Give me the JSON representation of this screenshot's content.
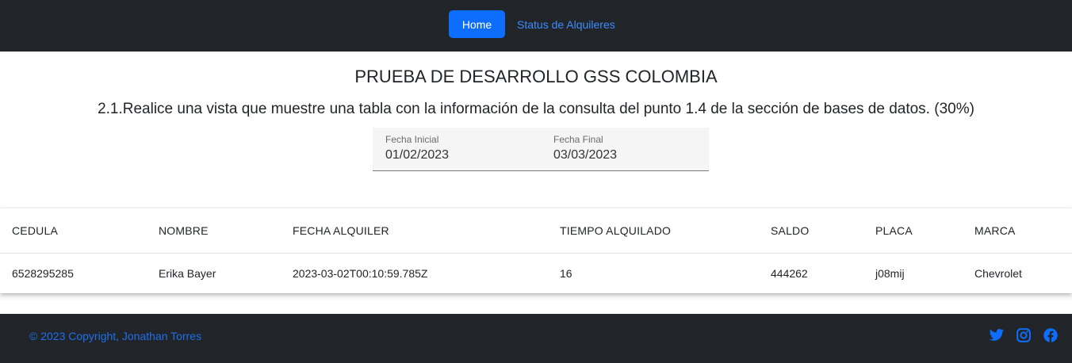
{
  "nav": {
    "home_label": "Home",
    "status_label": "Status de Alquileres"
  },
  "page": {
    "title": "PRUEBA DE DESARROLLO GSS COLOMBIA",
    "subtitle": "2.1.Realice una vista que muestre una tabla con la información de la consulta del punto 1.4 de la sección de bases de datos. (30%)"
  },
  "filters": {
    "start_label": "Fecha Inicial",
    "start_value": "01/02/2023",
    "end_label": "Fecha Final",
    "end_value": "03/03/2023"
  },
  "table": {
    "columns": [
      "CEDULA",
      "NOMBRE",
      "FECHA ALQUILER",
      "TIEMPO ALQUILADO",
      "SALDO",
      "PLACA",
      "MARCA"
    ],
    "rows": [
      [
        "6528295285",
        "Erika Bayer",
        "2023-03-02T00:10:59.785Z",
        "16",
        "444262",
        "j08mij",
        "Chevrolet"
      ]
    ]
  },
  "footer": {
    "copyright": "© 2023 Copyright, Jonathan Torres",
    "icons": [
      "twitter-icon",
      "instagram-icon",
      "facebook-icon"
    ]
  },
  "colors": {
    "navbar_bg": "#212529",
    "primary": "#0d6efd",
    "link": "#3d8bfd",
    "footer_text": "#1f6feb"
  }
}
